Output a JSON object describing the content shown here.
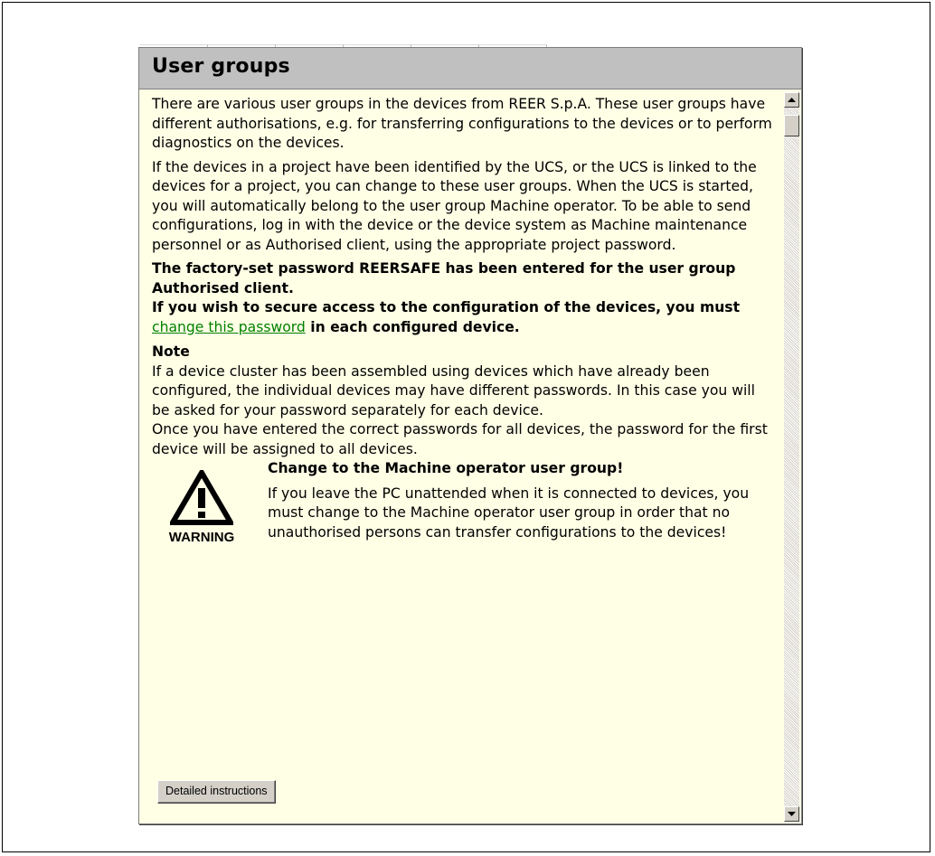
{
  "window": {
    "title": "User groups"
  },
  "content": {
    "para1": "There are various user groups in the devices from REER S.p.A. These user groups have different  authorisations, e.g. for transferring configurations to the devices  or to perform diagnostics on the devices.",
    "para2": "If the devices in a project have been identified by the UCS, or the UCS is linked to the devices for a project, you can change to these user groups. When the UCS is started, you will automatically belong to the user group Machine operator. To be able to send configurations, log in with the device or the device system as Machine maintenance personnel or as Authorised client, using the appropriate project password.",
    "bold1": "The factory-set password REERSAFE has been entered for the user group Authorised client.",
    "bold2_prefix": "If you wish to secure access to the  configuration of the devices, you must ",
    "bold2_link": "change this password",
    "bold2_suffix": " in  each configured device.",
    "note_title": "Note",
    "note_text1": "If a device cluster has been assembled using devices which have already been configured, the individual devices may have different passwords. In this case you will be asked for your password separately for each device.",
    "note_text2": "Once you have entered the correct passwords for all devices, the password for the first device will be assigned to all devices.",
    "warning_title": "Change to the Machine operator user group!",
    "warning_text": "If you leave the PC unattended when it is connected to devices, you must change to the Machine operator user group in order that no unauthorised persons can transfer configurations to the devices!",
    "warning_label": "WARNING"
  },
  "buttons": {
    "detailed": "Detailed instructions"
  },
  "icons": {
    "warning": "warning-triangle-icon",
    "scroll_up": "arrow-up-icon",
    "scroll_down": "arrow-down-icon"
  },
  "colors": {
    "background": "#ffffe6",
    "titlebar": "#c0c0c0",
    "link": "#008000"
  }
}
